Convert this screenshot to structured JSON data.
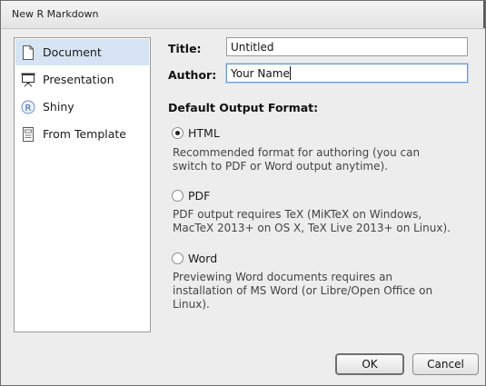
{
  "window": {
    "title": "New R Markdown"
  },
  "sidebar": {
    "items": [
      {
        "label": "Document",
        "icon": "document-icon",
        "selected": true
      },
      {
        "label": "Presentation",
        "icon": "presentation-icon",
        "selected": false
      },
      {
        "label": "Shiny",
        "icon": "shiny-icon",
        "selected": false
      },
      {
        "label": "From Template",
        "icon": "template-icon",
        "selected": false
      }
    ]
  },
  "form": {
    "title_label": "Title:",
    "title_value": "Untitled",
    "author_label": "Author:",
    "author_value": "Your Name"
  },
  "output": {
    "heading": "Default Output Format:",
    "selected": "HTML",
    "options": [
      {
        "label": "HTML",
        "desc_lines": [
          "Recommended format for authoring (you can",
          "switch to PDF or Word output anytime)."
        ]
      },
      {
        "label": "PDF",
        "desc_lines": [
          "PDF output requires TeX (MiKTeX on Windows,",
          "MacTeX 2013+ on OS X, TeX Live 2013+ on Linux)."
        ]
      },
      {
        "label": "Word",
        "desc_lines": [
          "Previewing Word documents requires an",
          "installation of MS Word (or Libre/Open Office on",
          "Linux)."
        ]
      }
    ]
  },
  "buttons": {
    "ok": "OK",
    "cancel": "Cancel"
  },
  "colors": {
    "selection": "#d6e4f3",
    "focus_border": "#6c9bd0"
  }
}
